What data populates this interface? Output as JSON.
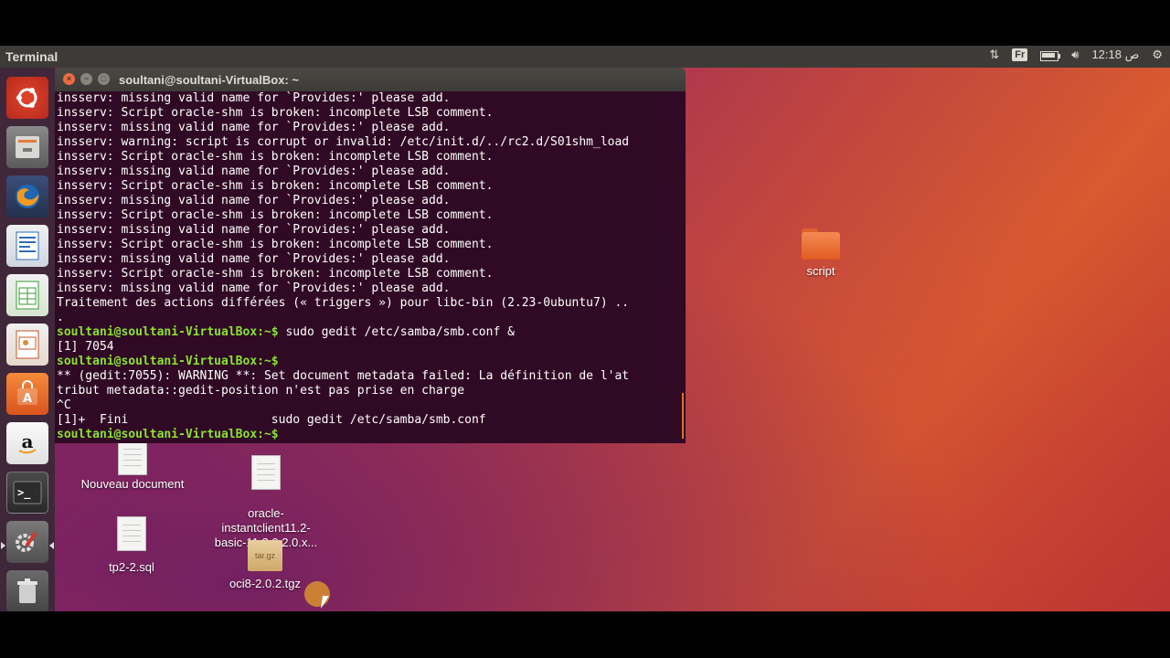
{
  "topbar": {
    "app_title": "Terminal",
    "tray": {
      "keyboard": "Fr",
      "clock_suffix": "ص",
      "clock": "12:18"
    }
  },
  "launcher": {
    "items": [
      "ubuntu-dash",
      "files",
      "firefox",
      "libreoffice-writer",
      "libreoffice-calc",
      "libreoffice-impress",
      "software-center",
      "amazon",
      "terminal",
      "system-settings",
      "trash"
    ]
  },
  "terminal": {
    "title": "soultani@soultani-VirtualBox: ~",
    "lines": [
      {
        "t": "insserv: missing valid name for `Provides:' please add."
      },
      {
        "t": "insserv: Script oracle-shm is broken: incomplete LSB comment."
      },
      {
        "t": "insserv: missing valid name for `Provides:' please add."
      },
      {
        "t": "insserv: warning: script is corrupt or invalid: /etc/init.d/../rc2.d/S01shm_load"
      },
      {
        "t": "insserv: Script oracle-shm is broken: incomplete LSB comment."
      },
      {
        "t": "insserv: missing valid name for `Provides:' please add."
      },
      {
        "t": "insserv: Script oracle-shm is broken: incomplete LSB comment."
      },
      {
        "t": "insserv: missing valid name for `Provides:' please add."
      },
      {
        "t": "insserv: Script oracle-shm is broken: incomplete LSB comment."
      },
      {
        "t": "insserv: missing valid name for `Provides:' please add."
      },
      {
        "t": "insserv: Script oracle-shm is broken: incomplete LSB comment."
      },
      {
        "t": "insserv: missing valid name for `Provides:' please add."
      },
      {
        "t": "insserv: Script oracle-shm is broken: incomplete LSB comment."
      },
      {
        "t": "insserv: missing valid name for `Provides:' please add."
      },
      {
        "t": "Traitement des actions différées (« triggers ») pour libc-bin (2.23-0ubuntu7) .."
      },
      {
        "t": "."
      },
      {
        "p": "soultani@soultani-VirtualBox:~$",
        "t": " sudo gedit /etc/samba/smb.conf &"
      },
      {
        "t": "[1] 7054"
      },
      {
        "p": "soultani@soultani-VirtualBox:~$",
        "t": ""
      },
      {
        "t": "** (gedit:7055): WARNING **: Set document metadata failed: La définition de l'at"
      },
      {
        "t": "tribut metadata::gedit-position n'est pas prise en charge"
      },
      {
        "t": "^C"
      },
      {
        "t": "[1]+  Fini                    sudo gedit /etc/samba/smb.conf"
      },
      {
        "p": "soultani@soultani-VirtualBox:~$",
        "t": ""
      }
    ]
  },
  "desktop": {
    "icons": {
      "script": "script",
      "new_doc": "Nouveau document",
      "oracle": "oracle-\ninstantclient11.2-\nbasic-11.2.0.2.0.x...",
      "tp2": "tp2-2.sql",
      "oci8": "oci8-2.0.2.tgz",
      "tgz_badge": "tar.gz"
    }
  }
}
